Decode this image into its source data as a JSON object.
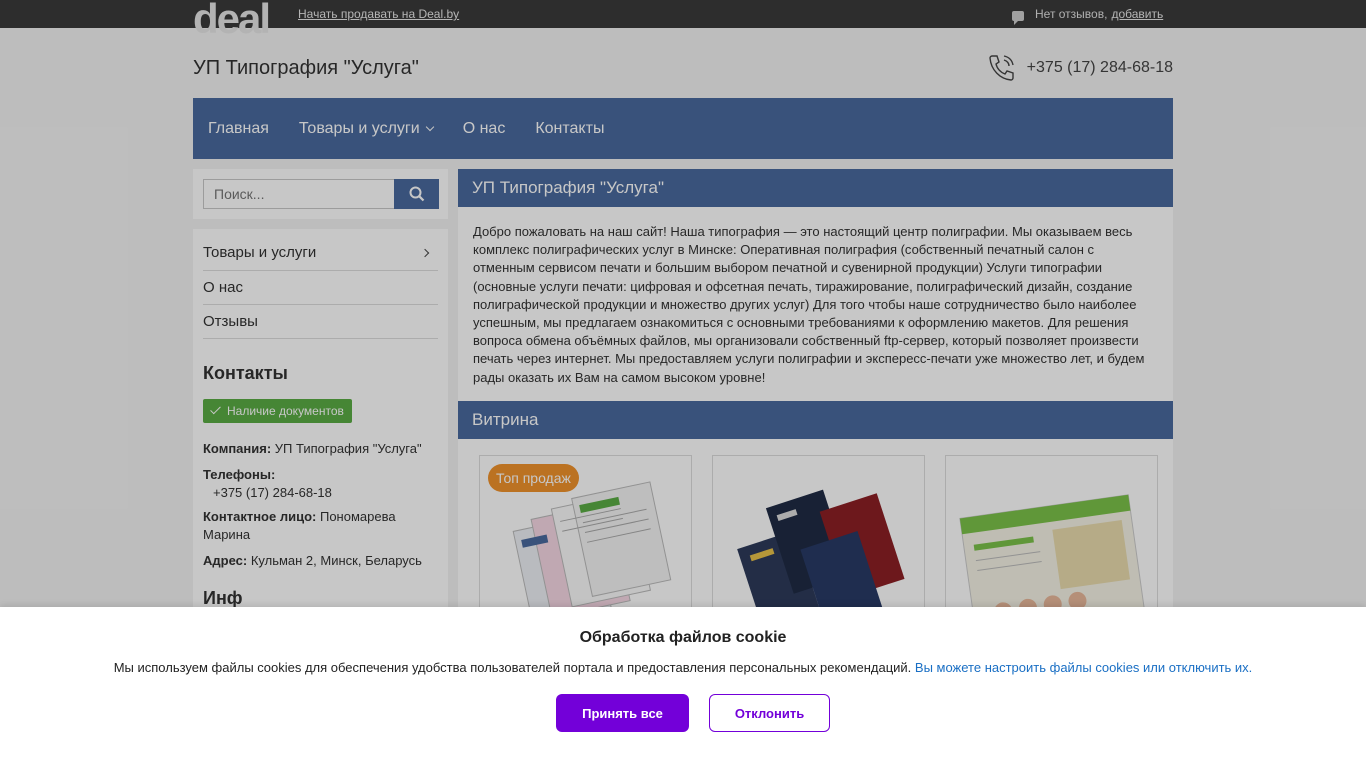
{
  "topbar": {
    "logo": "deal",
    "sell_link": "Начать продавать на Deal.by",
    "reviews_text": "Нет отзывов,",
    "reviews_add": "добавить"
  },
  "header": {
    "company": "УП Типография \"Услуга\"",
    "phone": "+375 (17) 284-68-18"
  },
  "nav": {
    "items": [
      {
        "label": "Главная"
      },
      {
        "label": "Товары и услуги"
      },
      {
        "label": "О нас"
      },
      {
        "label": "Контакты"
      }
    ]
  },
  "search": {
    "placeholder": "Поиск..."
  },
  "sidebar": {
    "menu": [
      {
        "label": "Товары и услуги"
      },
      {
        "label": "О нас"
      },
      {
        "label": "Отзывы"
      }
    ],
    "contacts_title": "Контакты",
    "docs_badge": "Наличие документов",
    "company_label": "Компания:",
    "company_value": "УП Типография \"Услуга\"",
    "phones_label": "Телефоны:",
    "phones_value": "+375 (17) 284-68-18",
    "contact_label": "Контактное лицо:",
    "contact_value": "Пономарева Марина",
    "address_label": "Адрес:",
    "address_value": "Кульман 2, Минск, Беларусь",
    "info_title": "Инф"
  },
  "main": {
    "title": "УП Типография \"Услуга\"",
    "text": "Добро пожаловать на наш сайт! Наша типография — это настоящий центр полиграфии. Мы оказываем весь комплекс полиграфических услуг в Минске: Оперативная полиграфия (собственный печатный салон с отменным сервисом печати и большим выбором печатной и сувенирной продукции) Услуги типографии (основные услуги печати: цифровая и офсетная печать, тиражирование, полиграфический дизайн, создание полиграфической продукции и множество других услуг) Для того чтобы наше сотрудничество было наиболее успешным, мы предлагаем ознакомиться с основными требованиями к оформлению макетов. Для решения вопроса обмена объёмных файлов, мы организовали собственный ftp-сервер, который позволяет произвести печать через интернет. Мы предоставляем услуги полиграфии и экспересс-печати уже множество лет, и будем рады оказать их Вам на самом высоком уровне!",
    "vitrina_title": "Витрина",
    "top_badge": "Топ продаж"
  },
  "cookie": {
    "title": "Обработка файлов cookie",
    "text": "Мы используем файлы cookies для обеспечения удобства пользователей портала и предоставления персональных рекомендаций.",
    "link": "Вы можете настроить файлы cookies или отключить их.",
    "accept": "Принять все",
    "decline": "Отклонить"
  },
  "colors": {
    "nav": "#4a6a9e",
    "badge_green": "#5aac44",
    "badge_orange": "#f0922c",
    "accent_purple": "#7300d9"
  }
}
